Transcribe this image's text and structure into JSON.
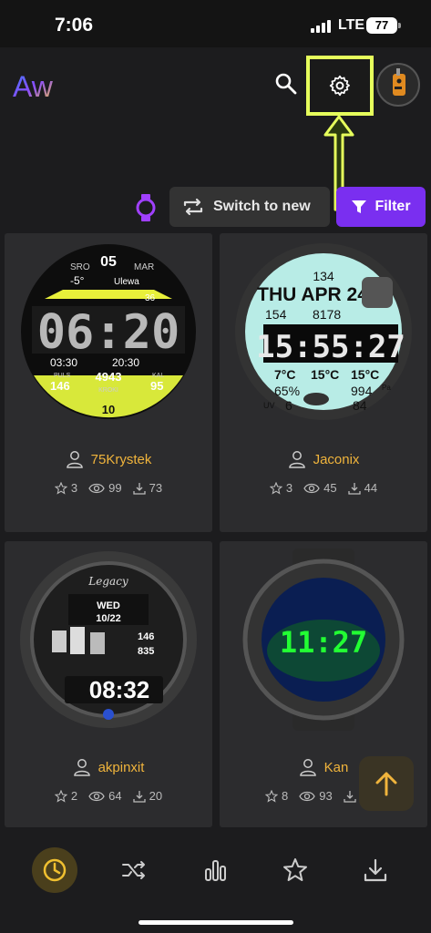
{
  "status_bar": {
    "time": "7:06",
    "network": "LTE",
    "battery": "77"
  },
  "header": {
    "logo_text": "Aw"
  },
  "toolbar": {
    "switch_label": "Switch to new",
    "filter_label": "Filter"
  },
  "cards": [
    {
      "author": "75Krystek",
      "stars": "3",
      "views": "99",
      "downloads": "73",
      "face": {
        "top_date": "05",
        "day": "SRO",
        "month": "MAR",
        "temp": "-5°",
        "city": "Ulewa",
        "time": "06:20",
        "alarm": "03:30",
        "timer": "20:30",
        "battery": "36",
        "puls_label": "PULS",
        "puls": "146",
        "steps": "4943",
        "steps_label": "KROKI",
        "kal_label": "KAL",
        "kal": "95",
        "bottom_num": "10"
      }
    },
    {
      "author": "Jaconix",
      "stars": "3",
      "views": "45",
      "downloads": "44",
      "face": {
        "alt": "134",
        "date": "THU APR 24",
        "hr": "154",
        "steps": "8178",
        "time": "15:55:27",
        "temp1": "7°C",
        "temp2": "15°C",
        "temp3": "15°C",
        "hum": "65%",
        "uv_label": "UV",
        "uv": "6",
        "pressure": "994",
        "pressure_unit": "Pa",
        "pct": "84"
      }
    },
    {
      "author": "akpinxit",
      "stars": "2",
      "views": "64",
      "downloads": "20",
      "face": {
        "brand": "Legacy",
        "day": "WED",
        "date": "10/22",
        "v1": "146",
        "v2": "835",
        "time": "08:32"
      }
    },
    {
      "author": "Kan",
      "stars": "8",
      "views": "93",
      "downloads": "",
      "face": {
        "time": "11:27"
      }
    }
  ],
  "colors": {
    "accent": "#7a2ff0",
    "author": "#f0b43c",
    "highlight": "#e6ff5c",
    "nav_active": "#f0c030"
  },
  "icons": [
    "search-icon",
    "gear-icon",
    "watch-icon",
    "switch-icon",
    "filter-icon",
    "user-icon",
    "star-icon",
    "eye-icon",
    "download-icon",
    "arrow-up-icon",
    "clock-icon",
    "shuffle-icon",
    "bar-chart-icon",
    "star-nav-icon",
    "download-nav-icon"
  ]
}
